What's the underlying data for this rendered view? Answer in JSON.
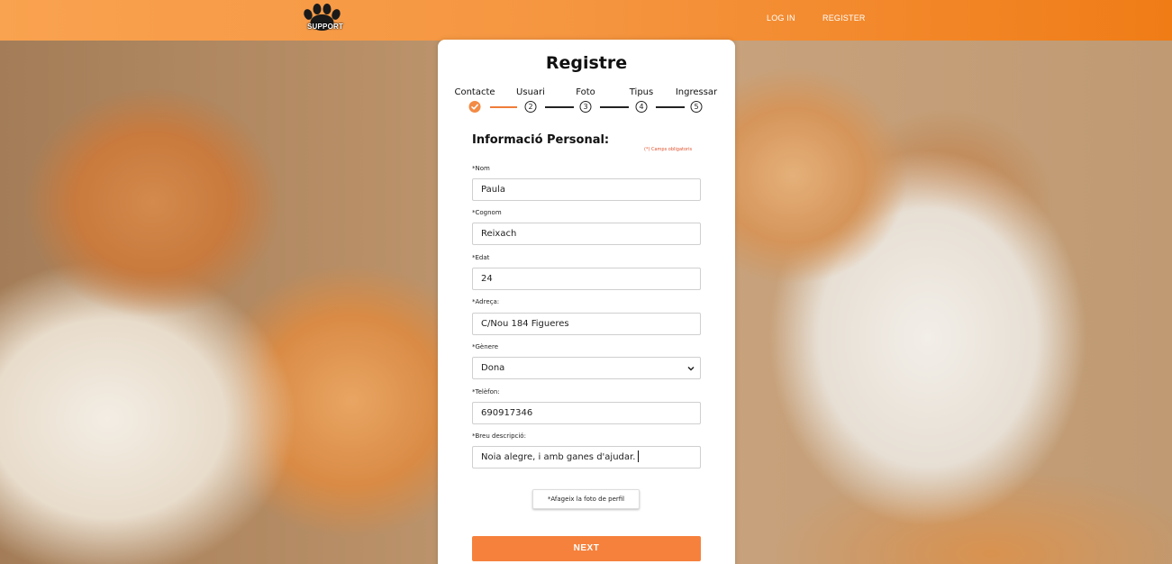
{
  "header": {
    "logo_text": "SUPPORT",
    "nav": {
      "login": "LOG IN",
      "register": "REGISTER"
    }
  },
  "form": {
    "title": "Registre",
    "steps": [
      {
        "label": "Contacte",
        "number": "",
        "done": true
      },
      {
        "label": "Usuari",
        "number": "2",
        "done": false
      },
      {
        "label": "Foto",
        "number": "3",
        "done": false
      },
      {
        "label": "Tipus",
        "number": "4",
        "done": false
      },
      {
        "label": "Ingressar",
        "number": "5",
        "done": false
      }
    ],
    "section_title": "Informació Personal:",
    "required_note": "(*) Camps obligatoris",
    "fields": {
      "nom": {
        "label": "*Nom",
        "value": "Paula"
      },
      "cognom": {
        "label": "*Cognom",
        "value": "Reixach"
      },
      "edat": {
        "label": "*Edat",
        "value": "24"
      },
      "adreca": {
        "label": "*Adreça:",
        "value": "C/Nou 184 Figueres"
      },
      "genere": {
        "label": "*Gènere",
        "value": "Dona"
      },
      "telefon": {
        "label": "*Telèfon:",
        "value": "690917346"
      },
      "descripcio": {
        "label": "*Breu descripció:",
        "value": "Noia alegre, i amb ganes d'ajudar."
      }
    },
    "photo_button": "*Afageix la foto de perfil",
    "next_button": "NEXT"
  },
  "colors": {
    "accent": "#f6813c",
    "header_start": "#f9a24f",
    "header_end": "#f07c16"
  }
}
